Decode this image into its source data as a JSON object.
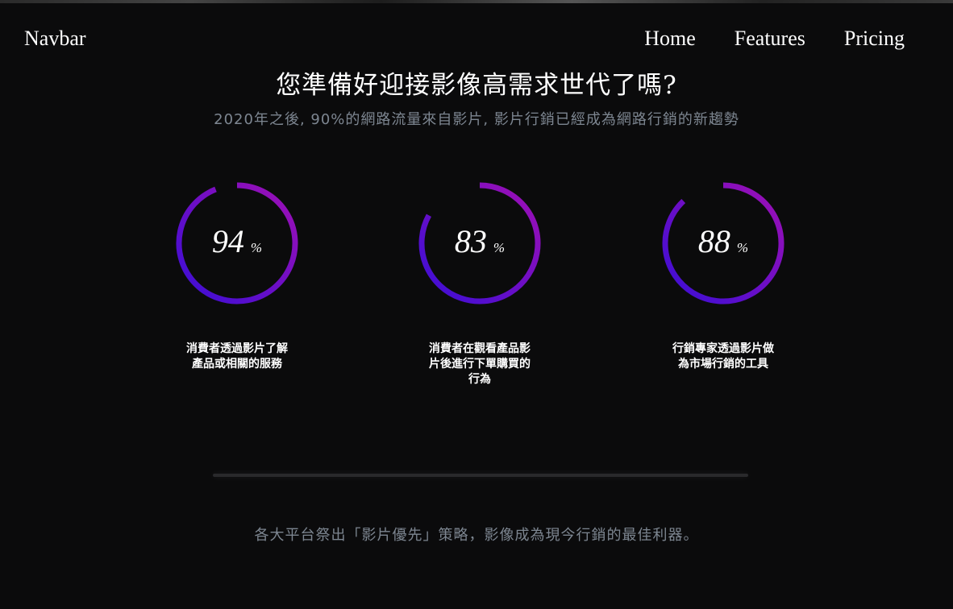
{
  "navbar": {
    "brand": "Navbar",
    "links": [
      "Home",
      "Features",
      "Pricing"
    ]
  },
  "hero": {
    "title": "您準備好迎接影像高需求世代了嗎?",
    "subtitle": "2020年之後, 90%的網路流量來自影片, 影片行銷已經成為網路行銷的新趨勢"
  },
  "stats": [
    {
      "value": 94,
      "value_text": "94",
      "unit": "%",
      "label": "消費者透過影片了解產品或相關的服務"
    },
    {
      "value": 83,
      "value_text": "83",
      "unit": "%",
      "label": "消費者在觀看產品影片後進行下單購買的行為"
    },
    {
      "value": 88,
      "value_text": "88",
      "unit": "%",
      "label": "行銷專家透過影片做為市場行銷的工具"
    }
  ],
  "footer_text": "各大平台祭出「影片優先」策略，影像成為現今行銷的最佳利器。",
  "colors": {
    "background": "#0b0b0c",
    "ring_start": "#a00fb4",
    "ring_end": "#3a0ed6",
    "muted_text": "#7d8691"
  }
}
